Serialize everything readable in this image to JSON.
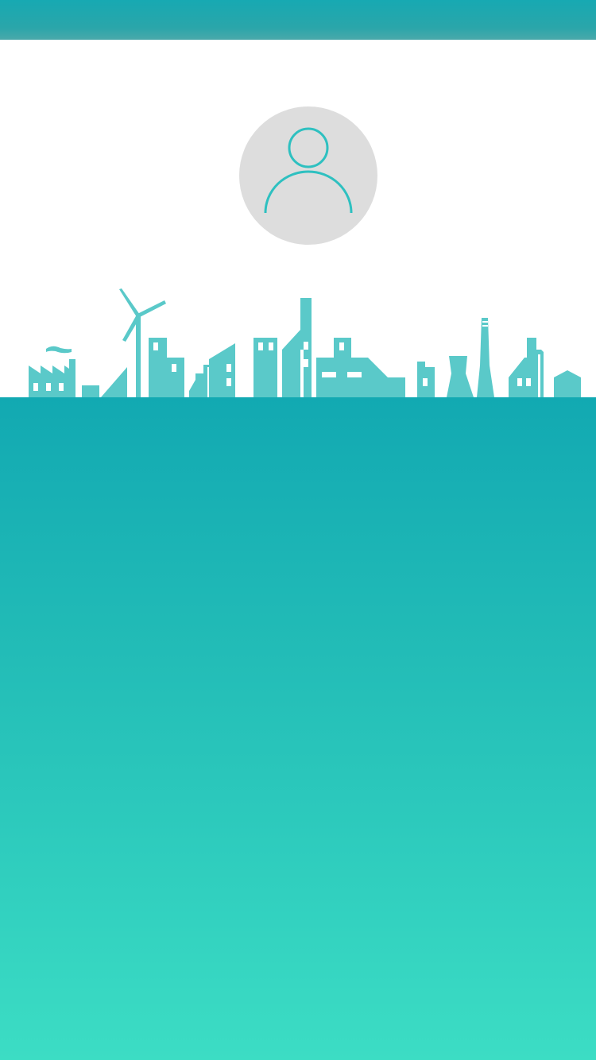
{
  "colors": {
    "brand_teal": "#17a9b2",
    "skyline": "#5ac9c9",
    "avatar_bg": "#dddddd",
    "avatar_stroke": "#2ec0c0",
    "gradient_bottom": "#3cddc4"
  },
  "icons": {
    "avatar": "user-outline-icon",
    "skyline": "city-skyline-illustration"
  }
}
